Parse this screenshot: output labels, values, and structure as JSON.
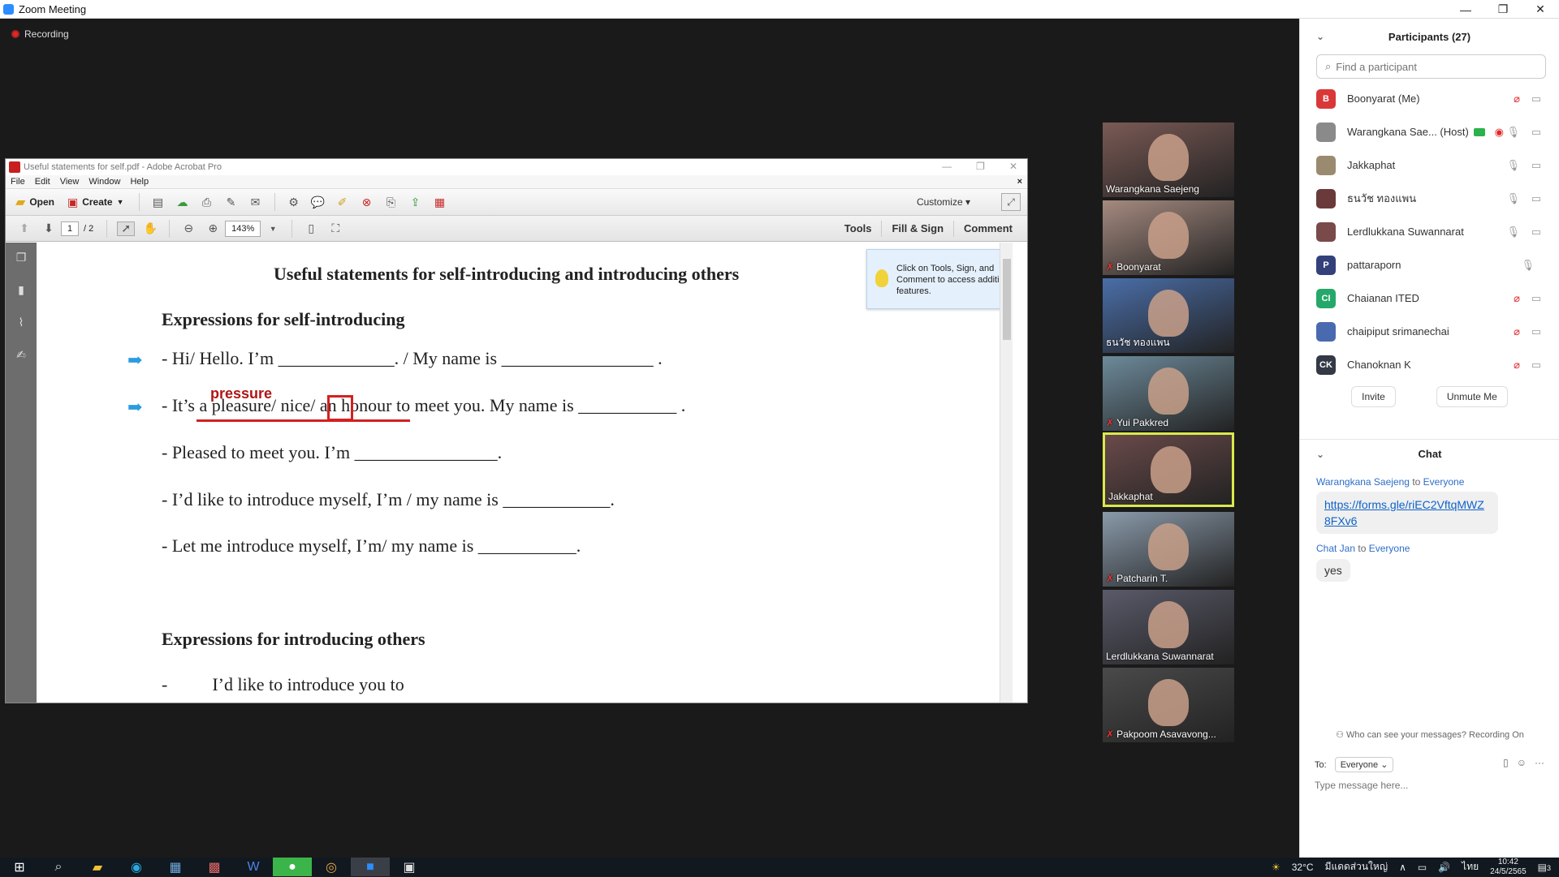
{
  "window": {
    "title": "Zoom Meeting",
    "controls": [
      "—",
      "❐",
      "✕"
    ]
  },
  "meeting": {
    "recording_label": "Recording"
  },
  "acrobat": {
    "title": "Useful statements for self.pdf - Adobe Acrobat Pro",
    "menu": [
      "File",
      "Edit",
      "View",
      "Window",
      "Help"
    ],
    "open_label": "Open",
    "create_label": "Create",
    "customize_label": "Customize",
    "page_current": "1",
    "page_total": "/ 2",
    "zoom": "143%",
    "tabs": [
      "Tools",
      "Fill & Sign",
      "Comment"
    ],
    "tip_text": "Click on Tools, Sign, and Comment to access additional features."
  },
  "document": {
    "title": "Useful statements for self-introducing and introducing others",
    "heading1": "Expressions for self-introducing",
    "lines": [
      "- Hi/ Hello. I’m _____________. / My name is _________________ .",
      "- It’s a pleasure/ nice/ an honour to meet you. My name is ___________ .",
      "- Pleased to meet you. I’m ________________.",
      "- I’d like to introduce myself, I’m / my name is ____________.",
      "- Let me introduce myself, I’m/ my name is ___________."
    ],
    "annotation": "pressure",
    "heading2": "Expressions for introducing others",
    "partial_line": "-          I’d like to introduce you to"
  },
  "videos": [
    {
      "name": "Warangkana Saejeng",
      "muted": false,
      "active": false
    },
    {
      "name": "Boonyarat",
      "muted": true,
      "active": false
    },
    {
      "name": "ธนวัช ทองแพน",
      "muted": false,
      "active": false
    },
    {
      "name": "Yui Pakkred",
      "muted": true,
      "active": false
    },
    {
      "name": "Jakkaphat",
      "muted": false,
      "active": true
    },
    {
      "name": "Patcharin T.",
      "muted": true,
      "active": false
    },
    {
      "name": "Lerdlukkana Suwannarat",
      "muted": false,
      "active": false
    },
    {
      "name": "Pakpoom Asavavong...",
      "muted": true,
      "active": false
    }
  ],
  "participants": {
    "title": "Participants (27)",
    "search_placeholder": "Find a participant",
    "list": [
      {
        "name": "Boonyarat (Me)",
        "initials": "B",
        "color": "#d93838",
        "mic": "off",
        "video": "off"
      },
      {
        "name": "Warangkana Sae... (Host)",
        "initials": "",
        "color": "#8a8a8a",
        "mic": "on",
        "video": "on"
      },
      {
        "name": "Jakkaphat",
        "initials": "",
        "color": "#9a8a70",
        "mic": "on",
        "video": "on"
      },
      {
        "name": "ธนวัช ทองแพน",
        "initials": "",
        "color": "#6a3a3a",
        "mic": "on",
        "video": "on"
      },
      {
        "name": "Lerdlukkana Suwannarat",
        "initials": "",
        "color": "#7a4a4a",
        "mic": "on",
        "video": "on"
      },
      {
        "name": "pattaraporn",
        "initials": "P",
        "color": "#34407a",
        "mic": "on",
        "video": "none"
      },
      {
        "name": "Chaianan ITED",
        "initials": "CI",
        "color": "#25a86a",
        "mic": "off",
        "video": "on"
      },
      {
        "name": "chaipiput srimanechai",
        "initials": "",
        "color": "#4a6ab0",
        "mic": "off",
        "video": "on"
      },
      {
        "name": "Chanoknan K",
        "initials": "CK",
        "color": "#333a45",
        "mic": "off",
        "video": "on"
      }
    ],
    "invite_label": "Invite",
    "unmute_label": "Unmute Me"
  },
  "chat": {
    "title": "Chat",
    "messages": [
      {
        "from": "Warangkana Saejeng",
        "to_word": "to",
        "to": "Everyone",
        "text": "https://forms.gle/riEC2VftqMWZ8FXv6"
      },
      {
        "from": "Chat Jan",
        "to_word": "to",
        "to": "Everyone",
        "text": "yes"
      }
    ],
    "visibility_note": "Who can see your messages? Recording On",
    "to_label": "To:",
    "to_value": "Everyone",
    "input_placeholder": "Type message here..."
  },
  "taskbar": {
    "weather": "32°C",
    "weather_desc": "มีแดดส่วนใหญ่",
    "lang": "ไทย",
    "time": "10:42",
    "date": "24/5/2565",
    "notifications": "3"
  }
}
